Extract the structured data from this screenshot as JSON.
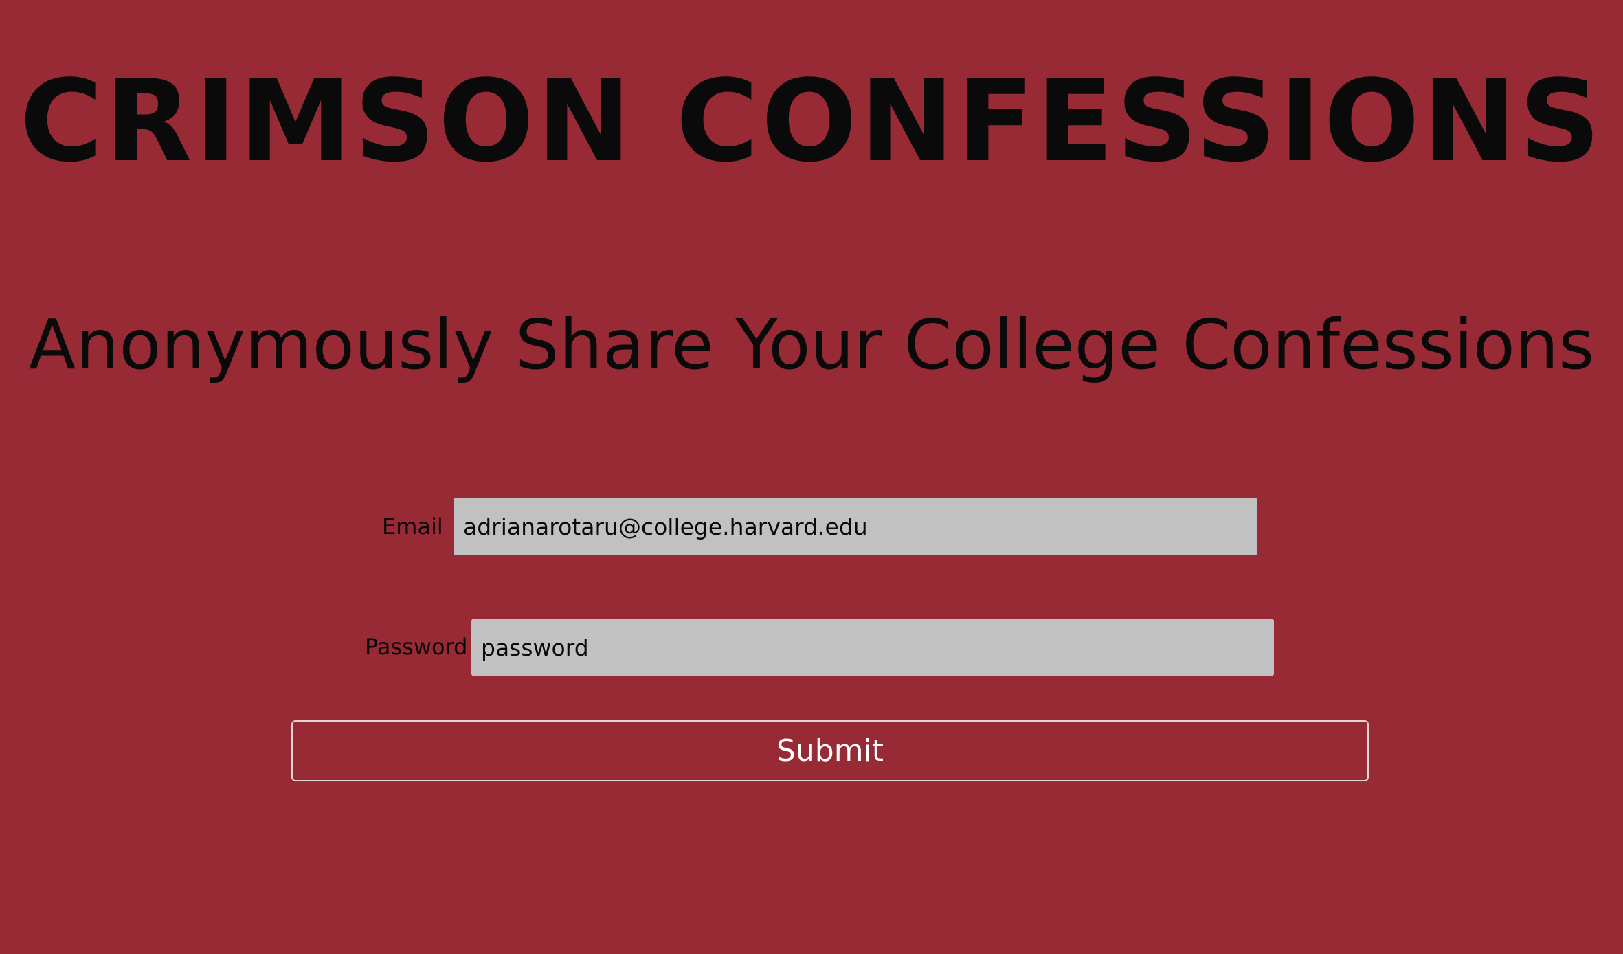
{
  "header": {
    "title": "CRIMSON CONFESSIONS",
    "tagline": "Anonymously Share Your College Confessions"
  },
  "form": {
    "email_label": "Email",
    "email_value": "adrianarotaru@college.harvard.edu",
    "password_label": "Password",
    "password_value": "password",
    "submit_label": "Submit"
  },
  "colors": {
    "background": "#982a36",
    "input_background": "#c1c1c1",
    "text": "#0a0a0a",
    "button_text": "#ffffff"
  }
}
